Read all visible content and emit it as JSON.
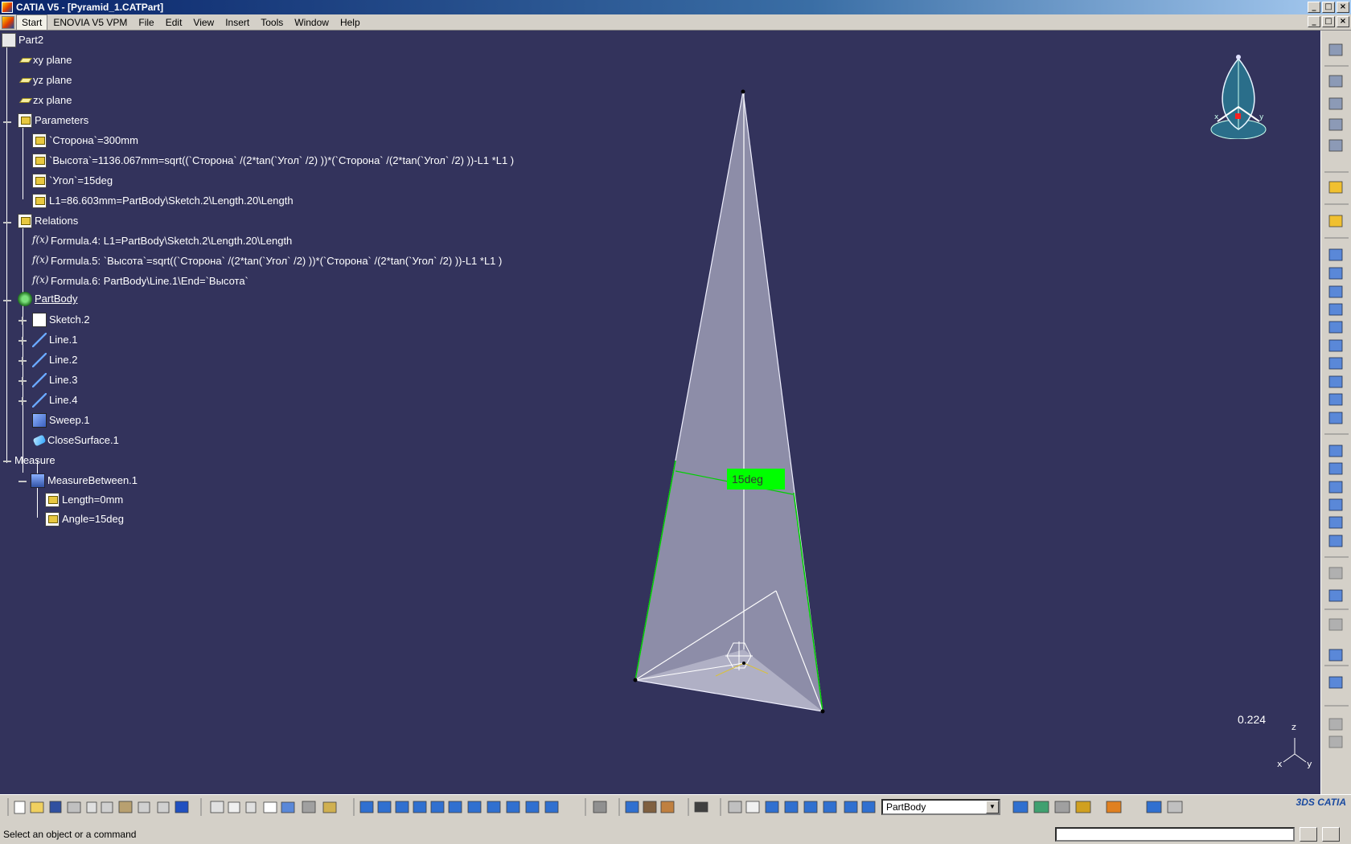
{
  "window": {
    "title": "CATIA V5 - [Pyramid_1.CATPart]",
    "controls": [
      "_",
      "□",
      "×"
    ]
  },
  "menubar": {
    "items": [
      "Start",
      "ENOVIA V5 VPM",
      "File",
      "Edit",
      "View",
      "Insert",
      "Tools",
      "Window",
      "Help"
    ],
    "active": "Start"
  },
  "tree": {
    "root": "Part2",
    "planes": [
      "xy plane",
      "yz plane",
      "zx plane"
    ],
    "parameters": {
      "label": "Parameters",
      "items": [
        "`Сторона`=300mm",
        "`Высота`=1136.067mm=sqrt((`Сторона` /(2*tan(`Угол` /2) ))*(`Сторона` /(2*tan(`Угол` /2) ))-L1 *L1 )",
        "`Угол`=15deg",
        "L1=86.603mm=PartBody\\Sketch.2\\Length.20\\Length"
      ]
    },
    "relations": {
      "label": "Relations",
      "items": [
        "Formula.4: L1=PartBody\\Sketch.2\\Length.20\\Length",
        "Formula.5: `Высота`=sqrt((`Сторона` /(2*tan(`Угол` /2) ))*(`Сторона` /(2*tan(`Угол` /2) ))-L1 *L1 )",
        "Formula.6: PartBody\\Line.1\\End=`Высота`"
      ]
    },
    "partbody": {
      "label": "PartBody",
      "items": [
        "Sketch.2",
        "Line.1",
        "Line.2",
        "Line.3",
        "Line.4",
        "Sweep.1",
        "CloseSurface.1"
      ]
    },
    "measure": {
      "label": "Measure",
      "child": "MeasureBetween.1",
      "items": [
        "Length=0mm",
        "Angle=15deg"
      ]
    }
  },
  "viewport": {
    "angle_label": "15deg",
    "zoom_value": "0.224",
    "axis_labels": [
      "z",
      "x",
      "y"
    ],
    "compass_labels": [
      "x",
      "y"
    ],
    "background_color": "#33335c",
    "highlight_color": "#00ff00"
  },
  "bottom_toolbar": {
    "workbench_value": "PartBody"
  },
  "statusbar": {
    "prompt": "Select an object or a command",
    "command_input_value": ""
  },
  "icons": {
    "titlebar": "catia-app-icon",
    "tree_planes": "plane-icon",
    "tree_params": "parameter-icon",
    "tree_formula": "formula-icon",
    "tree_body": "partbody-icon"
  }
}
